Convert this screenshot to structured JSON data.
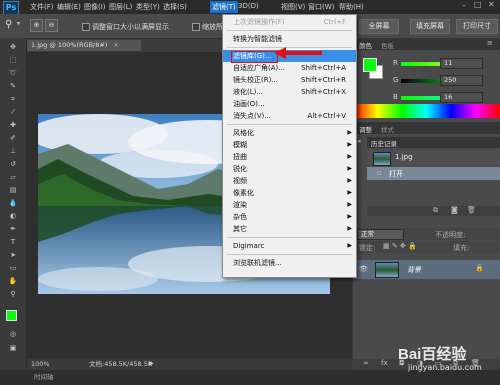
{
  "menubar": {
    "logo": "Ps",
    "items": [
      "文件(F)",
      "编辑(E)",
      "图像(I)",
      "图层(L)",
      "类型(Y)",
      "选择(S)",
      "滤镜(T)",
      "3D(D)",
      "视图(V)",
      "窗口(W)",
      "帮助(H)"
    ],
    "active_item": "滤镜(T)"
  },
  "options_bar": {
    "checkbox1_label": "调整窗口大小以满屏显示",
    "checkbox2_label": "缩放所有",
    "fill_screen": "填充屏幕",
    "print_size": "打印尺寸",
    "full_screen": "全屏幕"
  },
  "document": {
    "tab_title": "1.jpg @ 100%(RGB/8#)",
    "zoom": "100%",
    "doc_info": "文档:458.5K/458.5K"
  },
  "bottom_tab": "时间轴",
  "filter_menu": {
    "items": [
      {
        "label": "上次滤镜操作(F)",
        "shortcut": "Ctrl+F",
        "disabled": true
      },
      {
        "sep": true
      },
      {
        "label": "转换为智能滤镜"
      },
      {
        "sep": true
      },
      {
        "label": "滤镜库(G)...",
        "highlighted": true
      },
      {
        "label": "自适应广角(A)...",
        "shortcut": "Shift+Ctrl+A"
      },
      {
        "label": "镜头校正(R)...",
        "shortcut": "Shift+Ctrl+R"
      },
      {
        "label": "液化(L)...",
        "shortcut": "Shift+Ctrl+X"
      },
      {
        "label": "油画(O)..."
      },
      {
        "label": "消失点(V)...",
        "shortcut": "Alt+Ctrl+V"
      },
      {
        "sep": true
      },
      {
        "label": "风格化",
        "submenu": true
      },
      {
        "label": "模糊",
        "submenu": true
      },
      {
        "label": "扭曲",
        "submenu": true
      },
      {
        "label": "锐化",
        "submenu": true
      },
      {
        "label": "视频",
        "submenu": true
      },
      {
        "label": "像素化",
        "submenu": true
      },
      {
        "label": "渲染",
        "submenu": true
      },
      {
        "label": "杂色",
        "submenu": true
      },
      {
        "label": "其它",
        "submenu": true
      },
      {
        "sep": true
      },
      {
        "label": "Digimarc",
        "submenu": true
      },
      {
        "sep": true
      },
      {
        "label": "浏览联机滤镜..."
      }
    ]
  },
  "color_panel": {
    "tabs": [
      "颜色",
      "色板"
    ],
    "r": "11",
    "g": "250",
    "b": "16",
    "r_label": "R",
    "g_label": "G",
    "b_label": "B",
    "foreground": "#0bfa10"
  },
  "history_panel": {
    "tabs": [
      "调整",
      "样式"
    ],
    "title": "历史记录",
    "snapshot": "1.jpg",
    "state": "打开"
  },
  "layers_panel": {
    "mode": "正常",
    "opacity_label": "不透明度:",
    "lock_label": "锁定:",
    "fill_label": "填充:",
    "layer_name": "背景"
  },
  "watermark": {
    "brand": "Bai百经验",
    "url": "jingyan.baidu.com"
  }
}
